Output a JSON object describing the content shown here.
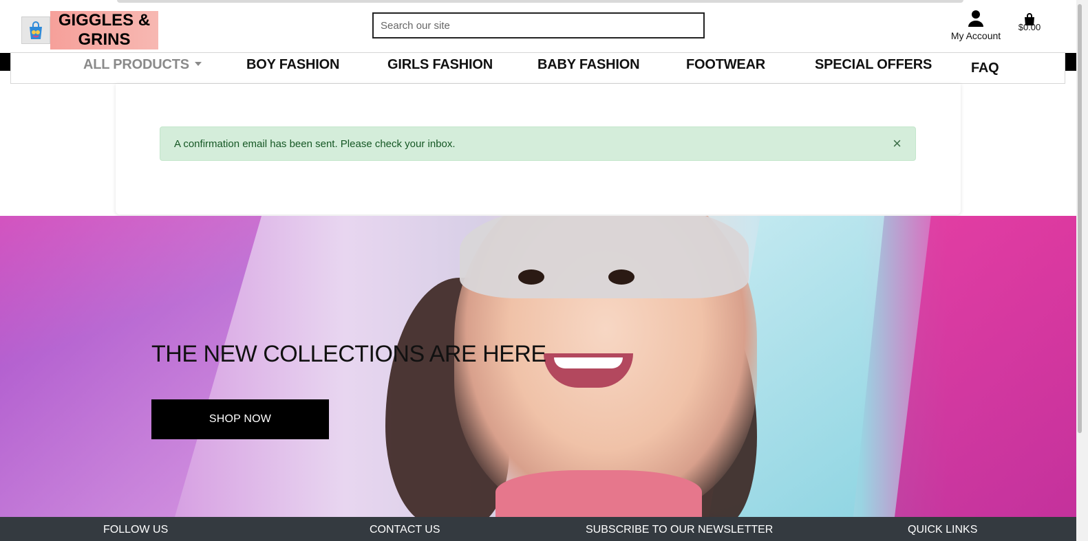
{
  "header": {
    "logo_text": "GIGGLES & GRINS",
    "search_placeholder": "Search our site",
    "account_label": "My Account",
    "cart_total": "$0.00"
  },
  "nav": {
    "items": [
      {
        "label": "ALL PRODUCTS",
        "dropdown": true
      },
      {
        "label": "BOY FASHION"
      },
      {
        "label": "GIRLS FASHION"
      },
      {
        "label": "BABY FASHION"
      },
      {
        "label": "FOOTWEAR"
      },
      {
        "label": "SPECIAL OFFERS"
      },
      {
        "label": "FAQ"
      }
    ]
  },
  "alert": {
    "message": "A confirmation email has been sent. Please check your inbox.",
    "close_symbol": "×",
    "color": "#d4edda"
  },
  "hero": {
    "title": "THE NEW COLLECTIONS ARE HERE",
    "button_label": "SHOP NOW"
  },
  "footer": {
    "columns": [
      "FOLLOW US",
      "CONTACT US",
      "SUBSCRIBE TO OUR NEWSLETTER",
      "QUICK LINKS"
    ],
    "color": "#343a40"
  }
}
